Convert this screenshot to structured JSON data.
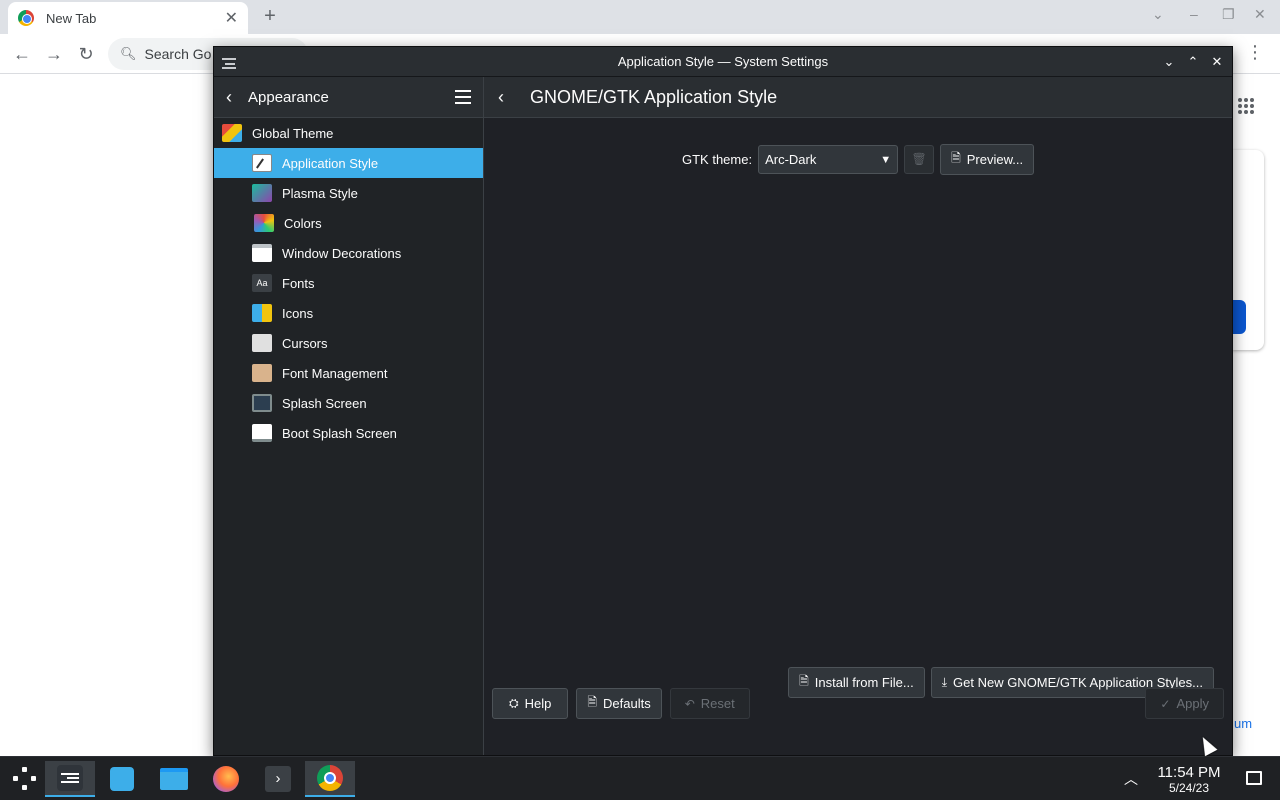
{
  "browser": {
    "tab_title": "New Tab",
    "tab_close": "✕",
    "new_tab": "+",
    "search_placeholder": "Search Go",
    "link_text": "um"
  },
  "window": {
    "title": "Application Style — System Settings"
  },
  "sidebar": {
    "header_title": "Appearance",
    "items": [
      {
        "label": "Global Theme",
        "icon": "global-theme-icon"
      },
      {
        "label": "Application Style",
        "icon": "application-style-icon",
        "selected": true
      },
      {
        "label": "Plasma Style",
        "icon": "plasma-style-icon"
      },
      {
        "label": "Colors",
        "icon": "colors-icon"
      },
      {
        "label": "Window Decorations",
        "icon": "window-decorations-icon"
      },
      {
        "label": "Fonts",
        "icon": "fonts-icon"
      },
      {
        "label": "Icons",
        "icon": "icons-icon"
      },
      {
        "label": "Cursors",
        "icon": "cursors-icon"
      },
      {
        "label": "Font Management",
        "icon": "font-management-icon"
      },
      {
        "label": "Splash Screen",
        "icon": "splash-screen-icon"
      },
      {
        "label": "Boot Splash Screen",
        "icon": "boot-splash-screen-icon"
      }
    ],
    "fonts_icon_text": "Aa"
  },
  "main": {
    "title": "GNOME/GTK Application Style",
    "gtk_theme_label": "GTK theme:",
    "gtk_theme_value": "Arc-Dark",
    "preview_label": "Preview...",
    "install_label": "Install from File...",
    "get_new_label": "Get New GNOME/GTK Application Styles...",
    "help_label": "Help",
    "defaults_label": "Defaults",
    "reset_label": "Reset",
    "apply_label": "Apply"
  },
  "taskbar": {
    "time": "11:54 PM",
    "date": "5/24/23"
  },
  "colors": {
    "accent": "#3daee9",
    "window_bg": "#1f2126",
    "header_bg": "#2a2e32"
  }
}
